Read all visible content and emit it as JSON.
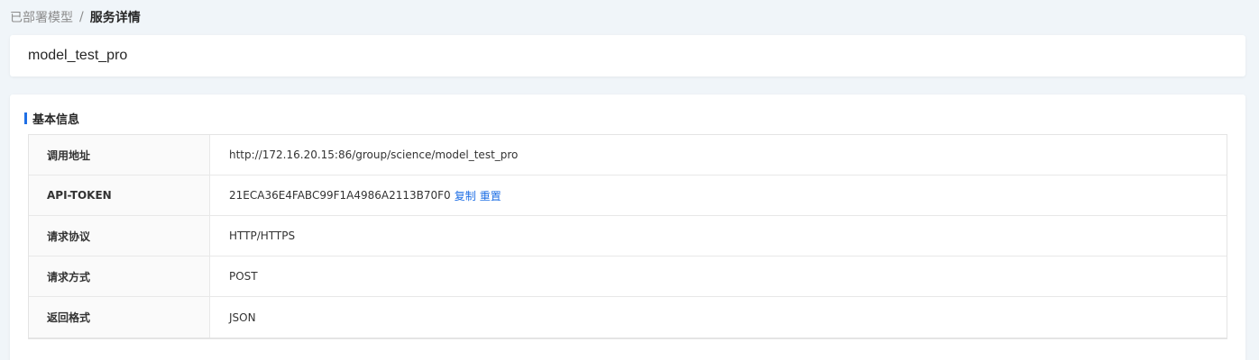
{
  "breadcrumb": {
    "parent": "已部署模型",
    "separator": "/",
    "current": "服务详情"
  },
  "header": {
    "model_name": "model_test_pro"
  },
  "basic_info": {
    "section_title": "基本信息",
    "accent_color": "#1f6fe5",
    "rows": [
      {
        "label": "调用地址",
        "value": "http://172.16.20.15:86/group/science/model_test_pro"
      },
      {
        "label": "API-TOKEN",
        "value": "21ECA36E4FABC99F1A4986A2113B70F0",
        "copy_label": "复制",
        "reset_label": "重置"
      },
      {
        "label": "请求协议",
        "value": "HTTP/HTTPS"
      },
      {
        "label": "请求方式",
        "value": "POST"
      },
      {
        "label": "返回格式",
        "value": "JSON"
      }
    ]
  }
}
